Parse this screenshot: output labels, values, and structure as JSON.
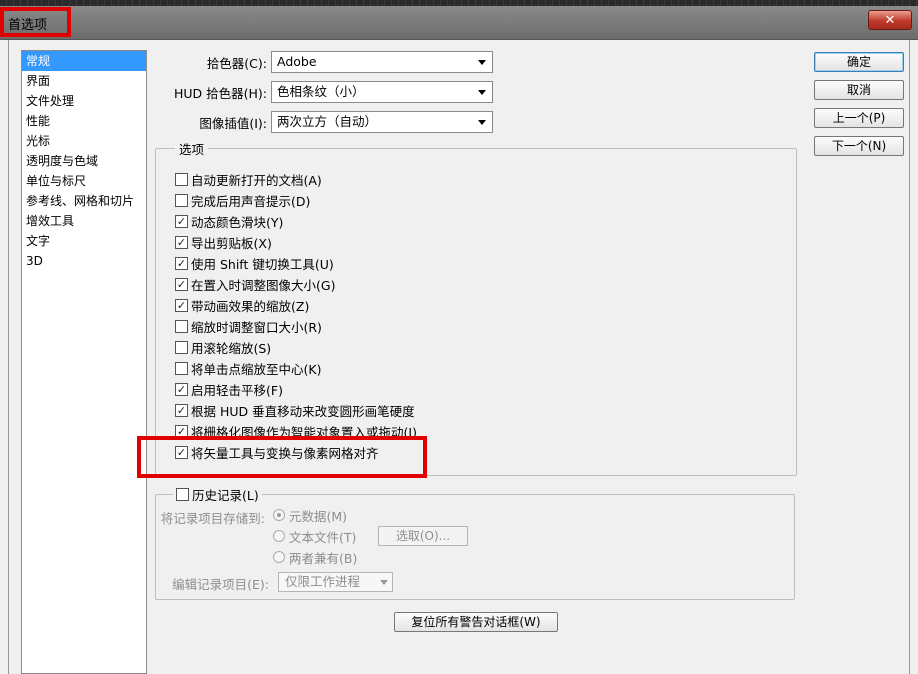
{
  "window": {
    "title": "首选项",
    "close_label": "✕"
  },
  "sidebar": {
    "items": [
      {
        "label": "常规"
      },
      {
        "label": "界面"
      },
      {
        "label": "文件处理"
      },
      {
        "label": "性能"
      },
      {
        "label": "光标"
      },
      {
        "label": "透明度与色域"
      },
      {
        "label": "单位与标尺"
      },
      {
        "label": "参考线、网格和切片"
      },
      {
        "label": "增效工具"
      },
      {
        "label": "文字"
      },
      {
        "label": "3D"
      }
    ],
    "selected": "常规"
  },
  "buttons": {
    "ok": "确定",
    "cancel": "取消",
    "prev": "上一个(P)",
    "next": "下一个(N)",
    "reset_warnings": "复位所有警告对话框(W)"
  },
  "fields": {
    "color_picker": {
      "label": "拾色器(C):",
      "value": "Adobe"
    },
    "hud_picker": {
      "label": "HUD 拾色器(H):",
      "value": "色相条纹（小）"
    },
    "interpolation": {
      "label": "图像插值(I):",
      "value": "两次立方（自动）"
    }
  },
  "options": {
    "legend": "选项",
    "items": [
      {
        "label": "自动更新打开的文档(A)",
        "checked": false
      },
      {
        "label": "完成后用声音提示(D)",
        "checked": false
      },
      {
        "label": "动态颜色滑块(Y)",
        "checked": true
      },
      {
        "label": "导出剪贴板(X)",
        "checked": true
      },
      {
        "label": "使用 Shift 键切换工具(U)",
        "checked": true
      },
      {
        "label": "在置入时调整图像大小(G)",
        "checked": true
      },
      {
        "label": "带动画效果的缩放(Z)",
        "checked": true
      },
      {
        "label": "缩放时调整窗口大小(R)",
        "checked": false
      },
      {
        "label": "用滚轮缩放(S)",
        "checked": false
      },
      {
        "label": "将单击点缩放至中心(K)",
        "checked": false
      },
      {
        "label": "启用轻击平移(F)",
        "checked": true
      },
      {
        "label": "根据 HUD 垂直移动来改变圆形画笔硬度",
        "checked": true
      },
      {
        "label": "将栅格化图像作为智能对象置入或拖动(J)",
        "checked": true
      },
      {
        "label": "将矢量工具与变换与像素网格对齐",
        "checked": true
      }
    ]
  },
  "history": {
    "label": "历史记录(L)",
    "checked": false,
    "save_to_label": "将记录项目存储到:",
    "radios": [
      {
        "label": "元数据(M)",
        "selected": true
      },
      {
        "label": "文本文件(T)",
        "selected": false
      },
      {
        "label": "两者兼有(B)",
        "selected": false
      }
    ],
    "choose_button": "选取(O)...",
    "edit_label": "编辑记录项目(E):",
    "edit_value": "仅限工作进程"
  }
}
